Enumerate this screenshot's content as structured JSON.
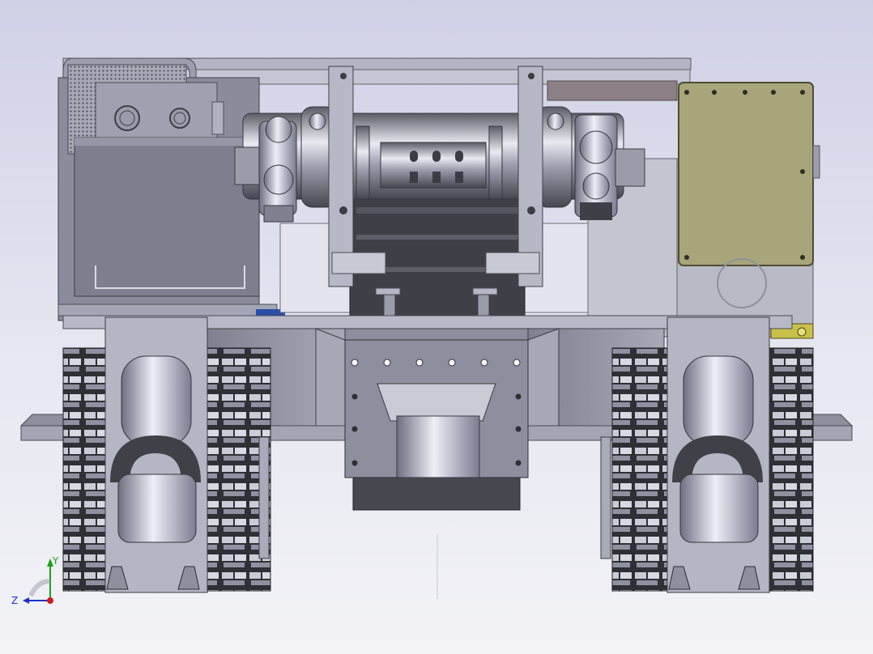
{
  "triad": {
    "y_label": "Y",
    "z_label": "Z",
    "colors": {
      "y": "#1aa21a",
      "z": "#1b2fc9",
      "x": "#d01a1a"
    }
  },
  "colors": {
    "background_top": "#cfd1e6",
    "metal": "#a9abb8",
    "dark_metal": "#3f4047",
    "olive_panel": "#a8a57a",
    "blue_accent": "#2a4fa8"
  }
}
